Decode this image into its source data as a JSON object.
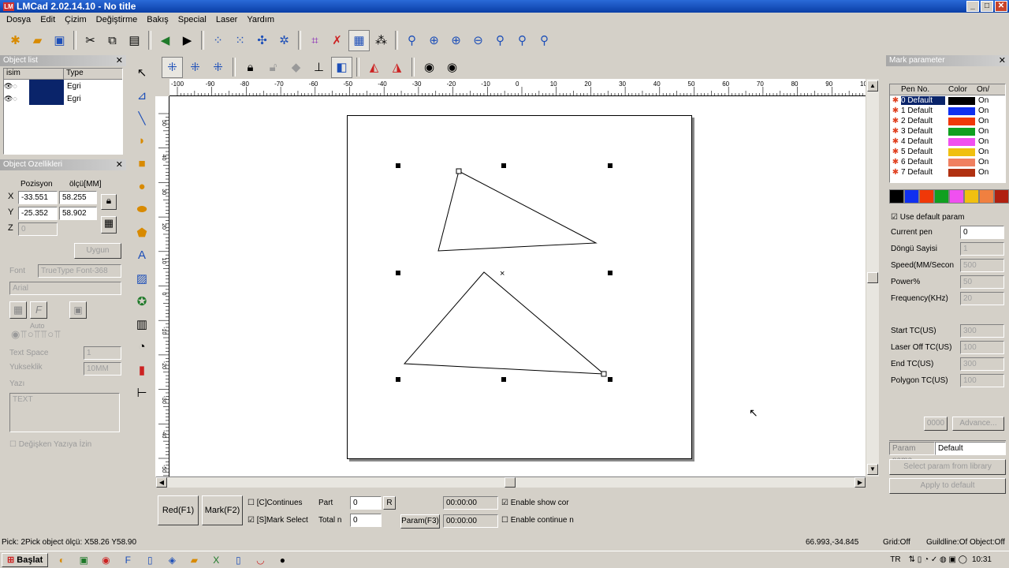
{
  "window": {
    "title": "LMCad 2.02.14.10 - No title",
    "min": "_",
    "max": "□",
    "close": "✕"
  },
  "menu": [
    "Dosya",
    "Edit",
    "Çizim",
    "Değiştirme",
    "Bakış",
    "Special",
    "Laser",
    "Yardım"
  ],
  "object_list": {
    "title": "Object list",
    "col_name": "isim",
    "col_type": "Type",
    "rows": [
      {
        "type": "Egri"
      },
      {
        "type": "Egri"
      }
    ]
  },
  "object_props": {
    "title": "Object Ozellikleri",
    "pos_label": "Pozisyon",
    "size_label": "ölçü[MM]",
    "x_label": "X",
    "y_label": "Y",
    "z_label": "Z",
    "x_pos": "-33.551",
    "x_size": "58.255",
    "y_pos": "-25.352",
    "y_size": "58.902",
    "z_pos": "0",
    "apply_label": "Uygun",
    "font_label": "Font",
    "font_type": "TrueType Font-368",
    "font_name": "Arial",
    "auto_label": "Auto",
    "text_space_label": "Text Space",
    "text_space_value": "1",
    "height_label": "Yukseklik",
    "height_value": "10MM",
    "text_label": "Yazı",
    "text_value": "TEXT",
    "variable_text_label": "Değişken Yazıya İzin"
  },
  "ruler": {
    "h_ticks": [
      "-100",
      "-90",
      "-80",
      "-70",
      "-60",
      "-50",
      "-40",
      "-30",
      "-20",
      "-10",
      "0",
      "10",
      "20",
      "30",
      "40",
      "50",
      "60",
      "70",
      "80",
      "90",
      "100"
    ],
    "v_ticks": [
      "50",
      "40",
      "30",
      "20",
      "10",
      "0",
      "-10",
      "-20",
      "-30",
      "-40",
      "-50"
    ]
  },
  "bottom_controls": {
    "red_label": "Red(F1)",
    "mark_label": "Mark(F2)",
    "continues_label": "[C]Continues",
    "mark_select_label": "[S]Mark Select",
    "part_label": "Part",
    "part_value": "0",
    "reset_label": "R",
    "total_label": "Total n",
    "total_value": "0",
    "time1": "00:00:00",
    "time2": "00:00:00",
    "param_label": "Param(F3)",
    "enable_show_label": "Enable show cor",
    "enable_continue_label": "Enable continue n"
  },
  "mark_param": {
    "title": "Mark parameter",
    "col_pen": "Pen No.",
    "col_color": "Color",
    "col_on": "On/",
    "pens": [
      {
        "name": "0 Default",
        "color": "#000000",
        "state": "On"
      },
      {
        "name": "1 Default",
        "color": "#1030f0",
        "state": "On"
      },
      {
        "name": "2 Default",
        "color": "#f03808",
        "state": "On"
      },
      {
        "name": "3 Default",
        "color": "#10a020",
        "state": "On"
      },
      {
        "name": "4 Default",
        "color": "#f050f0",
        "state": "On"
      },
      {
        "name": "5 Default",
        "color": "#f0c010",
        "state": "On"
      },
      {
        "name": "6 Default",
        "color": "#f08060",
        "state": "On"
      },
      {
        "name": "7 Default",
        "color": "#b03010",
        "state": "On"
      }
    ],
    "palette": [
      "#000000",
      "#1030f0",
      "#f03808",
      "#10a020",
      "#f050f0",
      "#f0c010",
      "#f08040",
      "#b02010"
    ],
    "use_default_label": "Use default param",
    "current_pen_label": "Current pen",
    "current_pen_value": "0",
    "loop_label": "Döngü Sayisi",
    "loop_value": "1",
    "speed_label": "Speed(MM/Secon",
    "speed_value": "500",
    "power_label": "Power%",
    "power_value": "50",
    "freq_label": "Frequency(KHz)",
    "freq_value": "20",
    "start_tc_label": "Start TC(US)",
    "start_tc_value": "300",
    "laser_off_label": "Laser Off TC(US)",
    "laser_off_value": "100",
    "end_tc_label": "End TC(US)",
    "end_tc_value": "300",
    "polygon_tc_label": "Polygon TC(US)",
    "polygon_tc_value": "100",
    "advance_label": "Advance...",
    "dots_label": "0000",
    "param_name_label": "Param name",
    "param_name_value": "Default",
    "select_lib_label": "Select param from library",
    "apply_default_label": "Apply to default"
  },
  "status": {
    "pick": "Pick: 2Pick object ölçü: X58.26 Y58.90",
    "coords": "66.993,-34.845",
    "grid": "Grid:Off",
    "guideline": "Guildline:Of",
    "object": "Object:Off"
  },
  "taskbar": {
    "start_label": "Başlat",
    "lang": "TR",
    "time": "10:31"
  }
}
